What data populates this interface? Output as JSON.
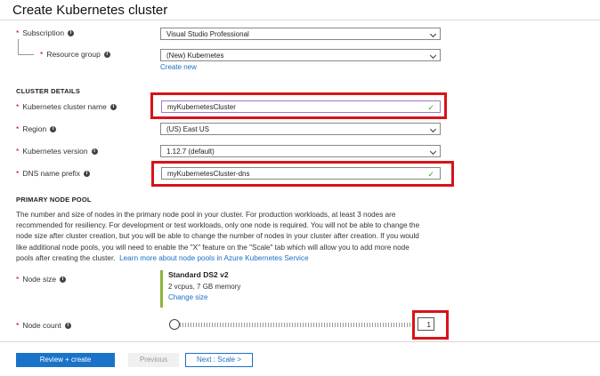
{
  "title": "Create Kubernetes cluster",
  "subscription": {
    "label": "Subscription",
    "value": "Visual Studio Professional"
  },
  "resource_group": {
    "label": "Resource group",
    "value": "(New) Kubernetes",
    "create_new": "Create new"
  },
  "cluster_details": {
    "heading": "CLUSTER DETAILS",
    "cluster_name": {
      "label": "Kubernetes cluster name",
      "value": "myKubernetesCluster"
    },
    "region": {
      "label": "Region",
      "value": "(US) East US"
    },
    "version": {
      "label": "Kubernetes version",
      "value": "1.12.7 (default)"
    },
    "dns_prefix": {
      "label": "DNS name prefix",
      "value": "myKubernetesCluster-dns"
    }
  },
  "primary_node_pool": {
    "heading": "PRIMARY NODE POOL",
    "description_lines": [
      "The number and size of nodes in the primary node pool in your cluster. For production workloads, at least 3 nodes are",
      "recommended for resiliency. For development or test workloads, only one node is required. You will not be able to change the",
      "node size after cluster creation, but you will be able to change the number of nodes in your cluster after creation. If you would",
      "like additional node pools, you will need to enable the \"X\" feature on the \"Scale\" tab which will allow you to add more node",
      "pools after creating the cluster."
    ],
    "learn_more": "Learn more about node pools in Azure Kubernetes Service",
    "node_size": {
      "label": "Node size",
      "name": "Standard DS2 v2",
      "spec": "2 vcpus, 7 GB memory",
      "change": "Change size"
    },
    "node_count": {
      "label": "Node count",
      "value": "1"
    }
  },
  "footer": {
    "review_create": "Review + create",
    "previous": "Previous",
    "next": "Next : Scale >"
  },
  "colors": {
    "accent": "#1a73c8",
    "highlight": "#d7131a",
    "valid": "#3c9b30"
  }
}
